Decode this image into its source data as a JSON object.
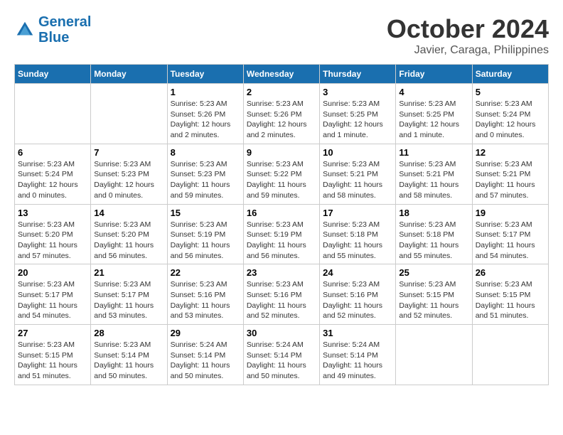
{
  "header": {
    "logo_line1": "General",
    "logo_line2": "Blue",
    "month": "October 2024",
    "location": "Javier, Caraga, Philippines"
  },
  "weekdays": [
    "Sunday",
    "Monday",
    "Tuesday",
    "Wednesday",
    "Thursday",
    "Friday",
    "Saturday"
  ],
  "weeks": [
    [
      {
        "day": "",
        "empty": true
      },
      {
        "day": "",
        "empty": true
      },
      {
        "day": "1",
        "sunrise": "5:23 AM",
        "sunset": "5:26 PM",
        "daylight": "12 hours and 2 minutes."
      },
      {
        "day": "2",
        "sunrise": "5:23 AM",
        "sunset": "5:26 PM",
        "daylight": "12 hours and 2 minutes."
      },
      {
        "day": "3",
        "sunrise": "5:23 AM",
        "sunset": "5:25 PM",
        "daylight": "12 hours and 1 minute."
      },
      {
        "day": "4",
        "sunrise": "5:23 AM",
        "sunset": "5:25 PM",
        "daylight": "12 hours and 1 minute."
      },
      {
        "day": "5",
        "sunrise": "5:23 AM",
        "sunset": "5:24 PM",
        "daylight": "12 hours and 0 minutes."
      }
    ],
    [
      {
        "day": "6",
        "sunrise": "5:23 AM",
        "sunset": "5:24 PM",
        "daylight": "12 hours and 0 minutes."
      },
      {
        "day": "7",
        "sunrise": "5:23 AM",
        "sunset": "5:23 PM",
        "daylight": "12 hours and 0 minutes."
      },
      {
        "day": "8",
        "sunrise": "5:23 AM",
        "sunset": "5:23 PM",
        "daylight": "11 hours and 59 minutes."
      },
      {
        "day": "9",
        "sunrise": "5:23 AM",
        "sunset": "5:22 PM",
        "daylight": "11 hours and 59 minutes."
      },
      {
        "day": "10",
        "sunrise": "5:23 AM",
        "sunset": "5:21 PM",
        "daylight": "11 hours and 58 minutes."
      },
      {
        "day": "11",
        "sunrise": "5:23 AM",
        "sunset": "5:21 PM",
        "daylight": "11 hours and 58 minutes."
      },
      {
        "day": "12",
        "sunrise": "5:23 AM",
        "sunset": "5:21 PM",
        "daylight": "11 hours and 57 minutes."
      }
    ],
    [
      {
        "day": "13",
        "sunrise": "5:23 AM",
        "sunset": "5:20 PM",
        "daylight": "11 hours and 57 minutes."
      },
      {
        "day": "14",
        "sunrise": "5:23 AM",
        "sunset": "5:20 PM",
        "daylight": "11 hours and 56 minutes."
      },
      {
        "day": "15",
        "sunrise": "5:23 AM",
        "sunset": "5:19 PM",
        "daylight": "11 hours and 56 minutes."
      },
      {
        "day": "16",
        "sunrise": "5:23 AM",
        "sunset": "5:19 PM",
        "daylight": "11 hours and 56 minutes."
      },
      {
        "day": "17",
        "sunrise": "5:23 AM",
        "sunset": "5:18 PM",
        "daylight": "11 hours and 55 minutes."
      },
      {
        "day": "18",
        "sunrise": "5:23 AM",
        "sunset": "5:18 PM",
        "daylight": "11 hours and 55 minutes."
      },
      {
        "day": "19",
        "sunrise": "5:23 AM",
        "sunset": "5:17 PM",
        "daylight": "11 hours and 54 minutes."
      }
    ],
    [
      {
        "day": "20",
        "sunrise": "5:23 AM",
        "sunset": "5:17 PM",
        "daylight": "11 hours and 54 minutes."
      },
      {
        "day": "21",
        "sunrise": "5:23 AM",
        "sunset": "5:17 PM",
        "daylight": "11 hours and 53 minutes."
      },
      {
        "day": "22",
        "sunrise": "5:23 AM",
        "sunset": "5:16 PM",
        "daylight": "11 hours and 53 minutes."
      },
      {
        "day": "23",
        "sunrise": "5:23 AM",
        "sunset": "5:16 PM",
        "daylight": "11 hours and 52 minutes."
      },
      {
        "day": "24",
        "sunrise": "5:23 AM",
        "sunset": "5:16 PM",
        "daylight": "11 hours and 52 minutes."
      },
      {
        "day": "25",
        "sunrise": "5:23 AM",
        "sunset": "5:15 PM",
        "daylight": "11 hours and 52 minutes."
      },
      {
        "day": "26",
        "sunrise": "5:23 AM",
        "sunset": "5:15 PM",
        "daylight": "11 hours and 51 minutes."
      }
    ],
    [
      {
        "day": "27",
        "sunrise": "5:23 AM",
        "sunset": "5:15 PM",
        "daylight": "11 hours and 51 minutes."
      },
      {
        "day": "28",
        "sunrise": "5:23 AM",
        "sunset": "5:14 PM",
        "daylight": "11 hours and 50 minutes."
      },
      {
        "day": "29",
        "sunrise": "5:24 AM",
        "sunset": "5:14 PM",
        "daylight": "11 hours and 50 minutes."
      },
      {
        "day": "30",
        "sunrise": "5:24 AM",
        "sunset": "5:14 PM",
        "daylight": "11 hours and 50 minutes."
      },
      {
        "day": "31",
        "sunrise": "5:24 AM",
        "sunset": "5:14 PM",
        "daylight": "11 hours and 49 minutes."
      },
      {
        "day": "",
        "empty": true
      },
      {
        "day": "",
        "empty": true
      }
    ]
  ],
  "labels": {
    "sunrise": "Sunrise:",
    "sunset": "Sunset:",
    "daylight": "Daylight:"
  }
}
